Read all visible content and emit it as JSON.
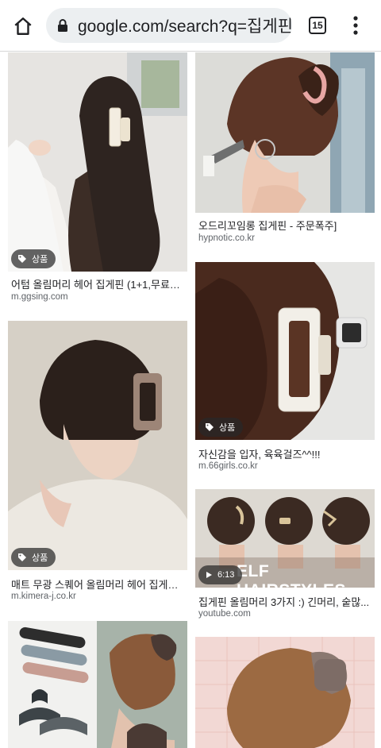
{
  "browser": {
    "url": "google.com/search?q=집게핀",
    "tab_count": "15"
  },
  "results": [
    {
      "caption": "어텀 올림머리 헤어 집게핀 (1+1,무료배...",
      "source": "m.ggsing.com",
      "badge": "상품"
    },
    {
      "caption": "오드리꼬임롱 집게핀 - 주문폭주]",
      "source": "hypnotic.co.kr",
      "badge": ""
    },
    {
      "caption": "자신감을 입자, 육육걸즈^^!!!",
      "source": "m.66girls.co.kr",
      "badge": "상품"
    },
    {
      "caption": "매트 무광 스퀘어 올림머리 헤어 집게핀 ...",
      "source": "m.kimera-j.co.kr",
      "badge": "상품"
    },
    {
      "caption": "집게핀 올림머리 3가지 :) 긴머리, 숱많...",
      "source": "youtube.com",
      "badge": "",
      "duration": "6:13",
      "overlay_text": "ELF HAIRSTYLES"
    }
  ]
}
